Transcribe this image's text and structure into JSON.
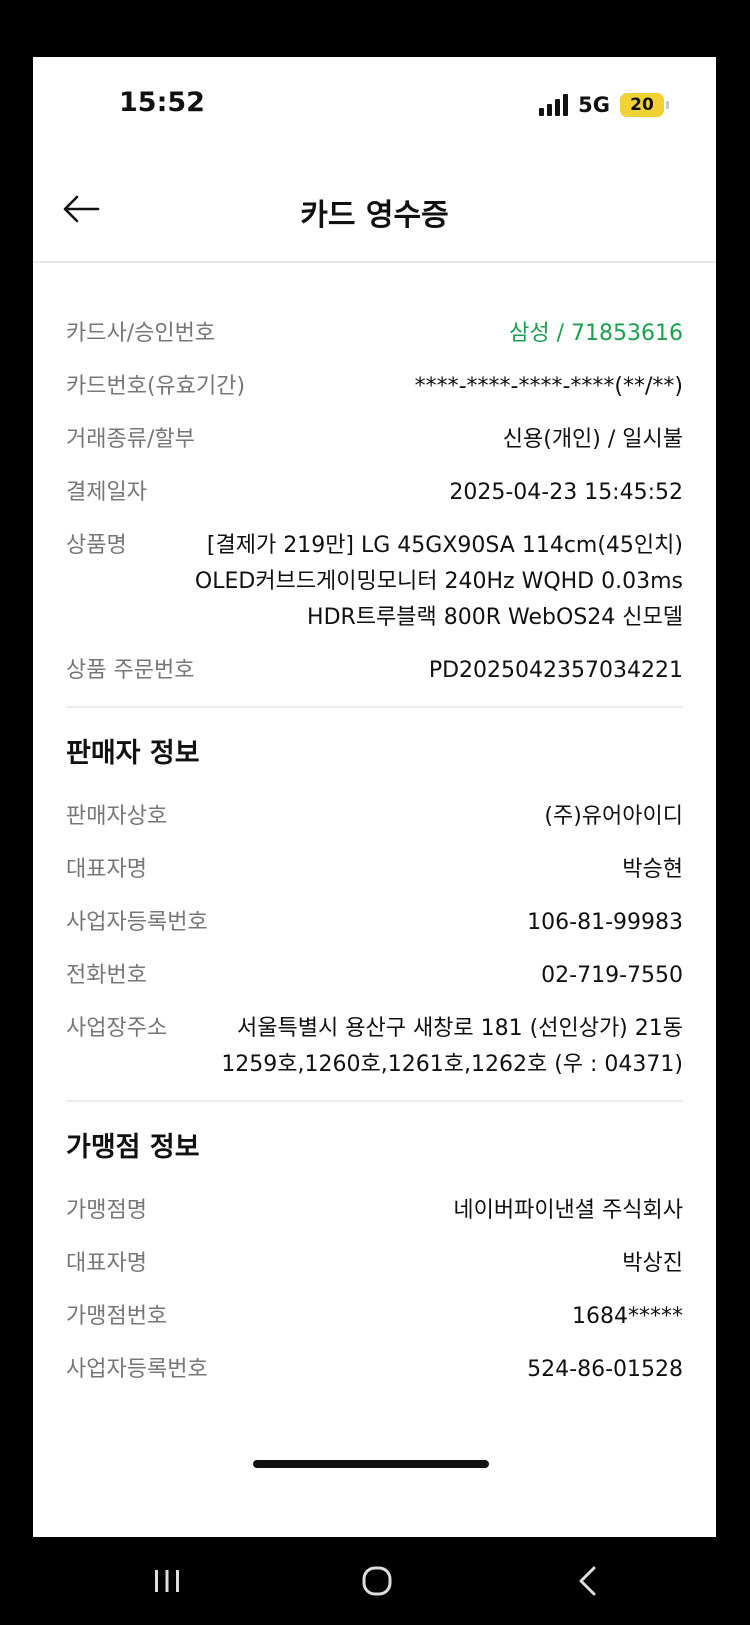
{
  "status_bar": {
    "time": "15:52",
    "network": "5G",
    "battery": "20"
  },
  "header": {
    "title": "카드 영수증",
    "back_icon": "arrow-left-icon"
  },
  "payment": {
    "card_approval": {
      "label": "카드사/승인번호",
      "value": "삼성 / 71853616"
    },
    "card_number": {
      "label": "카드번호(유효기간)",
      "value": "****-****-****-****(**/**)"
    },
    "transaction_type": {
      "label": "거래종류/할부",
      "value": "신용(개인) / 일시불"
    },
    "payment_date": {
      "label": "결제일자",
      "value": "2025-04-23 15:45:52"
    },
    "product_name": {
      "label": "상품명",
      "value": "[결제가 219만] LG 45GX90SA 114cm(45인치) OLED커브드게이밍모니터 240Hz WQHD 0.03ms HDR트루블랙 800R WebOS24 신모델"
    },
    "order_number": {
      "label": "상품 주문번호",
      "value": "PD2025042357034221"
    }
  },
  "seller": {
    "section_title": "판매자 정보",
    "company": {
      "label": "판매자상호",
      "value": "(주)유어아이디"
    },
    "representative": {
      "label": "대표자명",
      "value": "박승현"
    },
    "business_number": {
      "label": "사업자등록번호",
      "value": "106-81-99983"
    },
    "phone": {
      "label": "전화번호",
      "value": "02-719-7550"
    },
    "address": {
      "label": "사업장주소",
      "value": "서울특별시 용산구 새창로 181 (선인상가) 21동 1259호,1260호,1261호,1262호 (우 : 04371)"
    }
  },
  "merchant": {
    "section_title": "가맹점 정보",
    "name": {
      "label": "가맹점명",
      "value": "네이버파이낸셜 주식회사"
    },
    "representative": {
      "label": "대표자명",
      "value": "박상진"
    },
    "merchant_number": {
      "label": "가맹점번호",
      "value": "1684*****"
    },
    "business_number": {
      "label": "사업자등록번호",
      "value": "524-86-01528"
    }
  },
  "colors": {
    "accent_green": "#1aa14d",
    "label_gray": "#777777",
    "battery_yellow": "#f1d235"
  }
}
